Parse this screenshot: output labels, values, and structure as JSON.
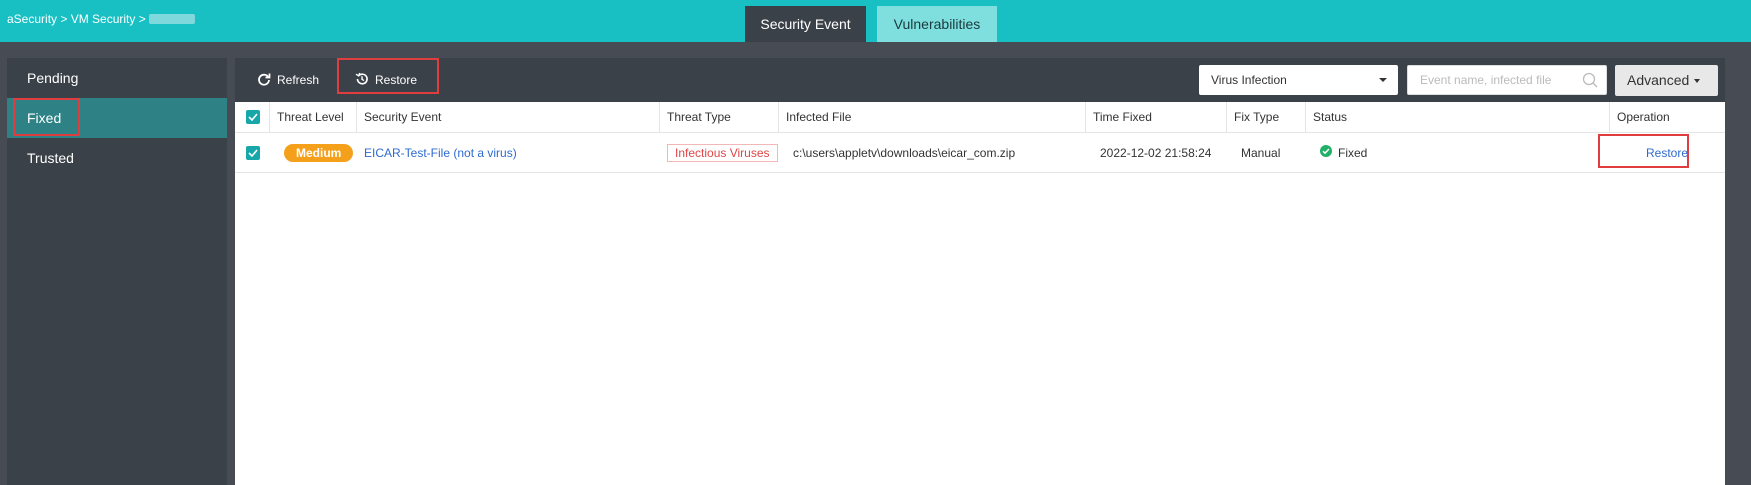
{
  "breadcrumb": {
    "text": "aSecurity > VM Security >"
  },
  "top_tabs": [
    {
      "label": "Security Event",
      "active": true
    },
    {
      "label": "Vulnerabilities",
      "active": false
    }
  ],
  "sidebar": {
    "items": [
      {
        "label": "Pending"
      },
      {
        "label": "Fixed",
        "active": true
      },
      {
        "label": "Trusted"
      }
    ]
  },
  "toolbar": {
    "refresh_label": "Refresh",
    "restore_label": "Restore",
    "filter_value": "Virus Infection",
    "search_placeholder": "Event name, infected file",
    "advanced_label": "Advanced"
  },
  "table": {
    "headers": [
      "Threat Level",
      "Security Event",
      "Threat Type",
      "Infected File",
      "Time Fixed",
      "Fix Type",
      "Status",
      "Operation"
    ],
    "rows": [
      {
        "threat_level": "Medium",
        "security_event": "EICAR-Test-File (not a virus)",
        "threat_type": "Infectious Viruses",
        "infected_file": "c:\\users\\appletv\\downloads\\eicar_com.zip",
        "time_fixed": "2022-12-02 21:58:24",
        "fix_type": "Manual",
        "status": "Fixed",
        "operation": "Restore"
      }
    ]
  },
  "colors": {
    "teal_header": "#18c0c4",
    "dark_panel": "#3b4148",
    "active_sidebar": "#2e8286",
    "medium_badge": "#f5a01a",
    "threat_red": "#e04646",
    "link_blue": "#2e6bd0",
    "highlight_red": "#e03e3e"
  }
}
